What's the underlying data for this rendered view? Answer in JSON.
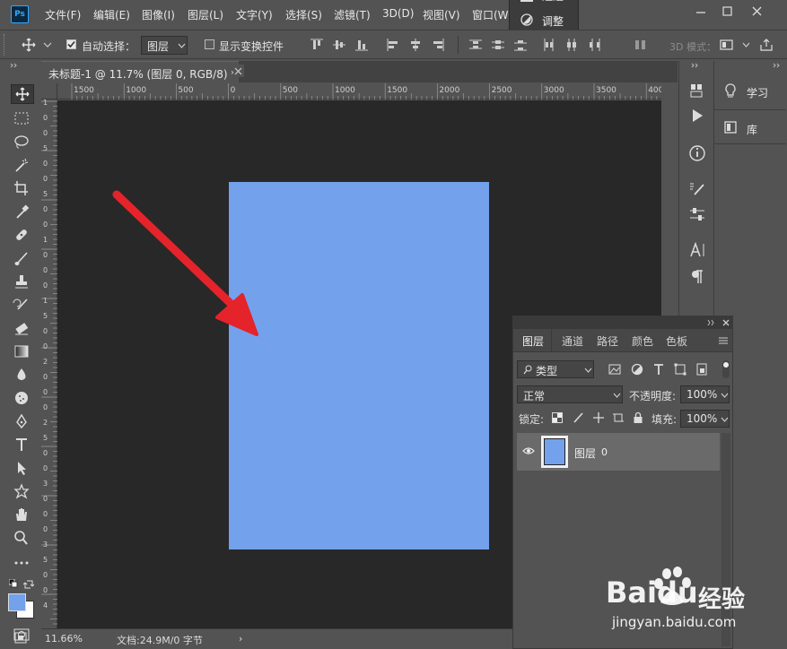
{
  "menubar": {
    "logo": "Ps",
    "items": [
      "文件(F)",
      "编辑(E)",
      "图像(I)",
      "图层(L)",
      "文字(Y)",
      "选择(S)",
      "滤镜(T)",
      "3D(D)",
      "视图(V)",
      "窗口(W"
    ]
  },
  "dropdown": {
    "partial_label": "通道",
    "item_label": "调整"
  },
  "options": {
    "auto_select_label": "自动选择：",
    "auto_select_checked": true,
    "target_value": "图层",
    "show_transform_label": "显示变换控件",
    "show_transform_checked": false,
    "mode_3d_label": "3D 模式："
  },
  "document": {
    "tab_title": "未标题-1 @ 11.7% (图层 0, RGB/8) *",
    "ruler_top_ticks": [
      "1500",
      "1000",
      "500",
      "0",
      "500",
      "1000",
      "1500",
      "2000",
      "2500",
      "3000",
      "3500",
      "400"
    ],
    "ruler_left_ticks": [
      "1",
      "0",
      "0",
      "5",
      "0",
      "0",
      "5",
      "0",
      "0",
      "1",
      "0",
      "0",
      "0",
      "1",
      "5",
      "0",
      "0",
      "2",
      "0",
      "0",
      "0",
      "2",
      "5",
      "0",
      "0",
      "3",
      "0",
      "0",
      "0",
      "3",
      "5",
      "0",
      "0",
      "4"
    ],
    "canvas_color": "#73a1ec"
  },
  "status": {
    "zoom": "11.66%",
    "doc_info": "文档:24.9M/0 字节",
    "arrow": "›"
  },
  "right_panels": {
    "learn_label": "学习",
    "library_label": "库"
  },
  "layers_panel": {
    "tabs": [
      "图层",
      "通道",
      "路径",
      "颜色",
      "色板"
    ],
    "filter_label": "类型",
    "blend_mode": "正常",
    "opacity_label": "不透明度:",
    "opacity_value": "100%",
    "lock_label": "锁定:",
    "fill_label": "填充:",
    "fill_value": "100%",
    "layers": [
      {
        "name": "图层",
        "suffix": "0",
        "visible": true
      }
    ]
  },
  "watermark": {
    "brand": "Baidu",
    "product": "经验",
    "url": "jingyan.baidu.com"
  },
  "colors": {
    "ui_bg": "#535353",
    "dark_bg": "#282828",
    "canvas_fill": "#73a1ec",
    "arrow_red": "#e5232a",
    "foreground_swatch": "#73a1ec",
    "background_swatch": "#ffffff"
  }
}
